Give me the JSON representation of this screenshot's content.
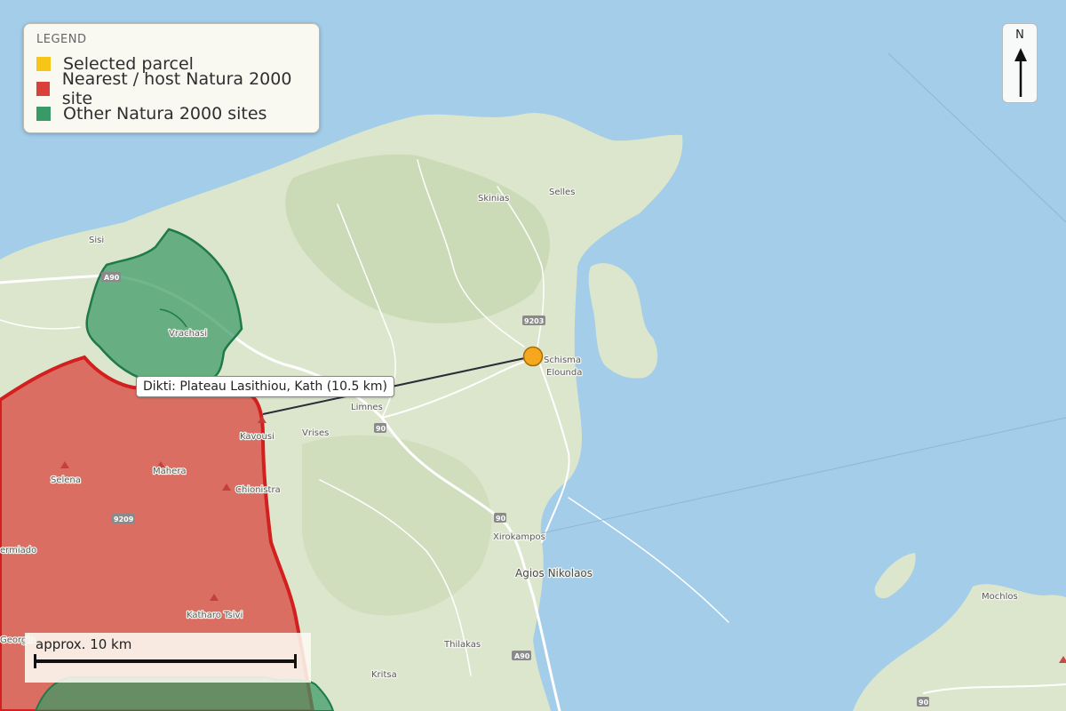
{
  "legend": {
    "title": "LEGEND",
    "items": [
      {
        "label": "Selected parcel",
        "color": "#f5c518"
      },
      {
        "label": "Nearest / host Natura 2000 site",
        "color": "#d9403a"
      },
      {
        "label": "Other Natura 2000 sites",
        "color": "#3a9a67"
      }
    ]
  },
  "north_arrow": {
    "label": "N"
  },
  "scale_bar": {
    "label": "approx. 10 km"
  },
  "distance_label": "Dikti: Plateau Lasithiou, Kath  (10.5 km)",
  "colors": {
    "sea": "#a3cde9",
    "land": "#dce6cc",
    "land_dark": "#c4d6ae",
    "road": "#ffffff",
    "parcel_fill": "#f5a81f",
    "host_site_fill": "#d9403a",
    "host_site_outline": "#d41f1f",
    "other_site_fill": "#3a9a67",
    "other_site_outline": "#1f7a4a"
  },
  "places": {
    "sisi": "Sisi",
    "skinias": "Skinias",
    "selles": "Selles",
    "vrachasi": "Vrachasi",
    "schisma": "Schisma",
    "elounda": "Elounda",
    "limnes": "Limnes",
    "vrises": "Vrises",
    "kavousi": "Kavousi",
    "selena": "Selena",
    "mahera": "Mahera",
    "chionistra": "Chionistra",
    "ermiado": "ermiado",
    "katharo": "Katharo Tsivi",
    "georgio": "Georgio",
    "xirokampos": "Xirokampos",
    "agios": "Agios Nikolaos",
    "thilakas": "Thilakas",
    "kritsa": "Kritsa",
    "mochlos": "Mochlos"
  },
  "roads": {
    "a90_west": "A90",
    "r9203": "9203",
    "r90_a": "90",
    "r90_b": "90",
    "r9209": "9209",
    "a90_south": "A90",
    "r90_east": "90"
  }
}
